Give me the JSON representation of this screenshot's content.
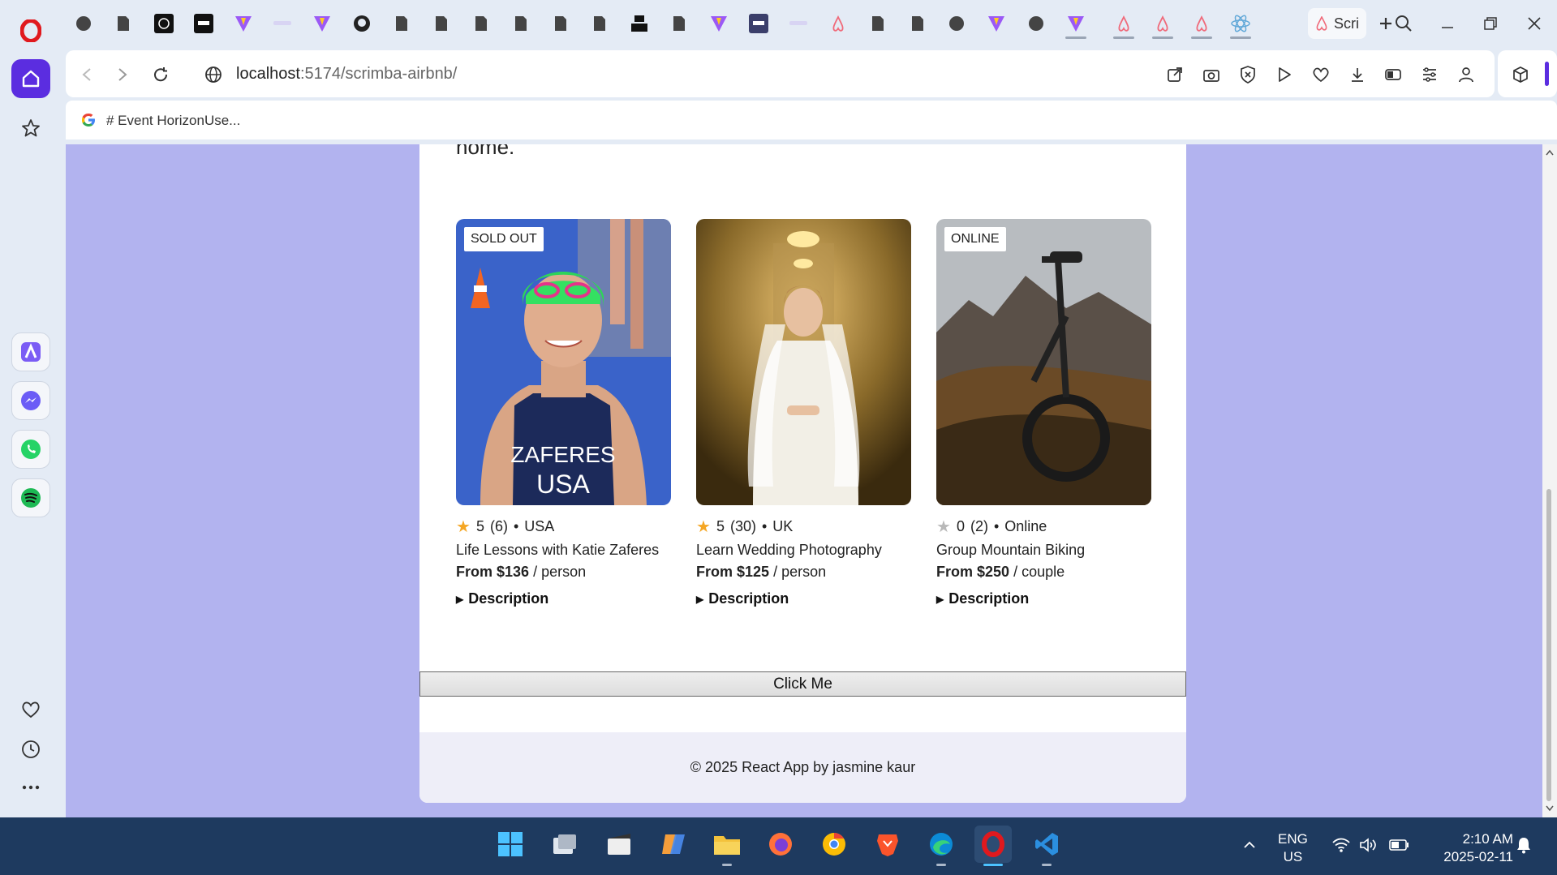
{
  "browser": {
    "active_tab_label": "Scri",
    "url_host": "localhost",
    "url_path": ":5174/scrimba-airbnb/",
    "bookmark_text": "# Event HorizonUse..."
  },
  "page": {
    "intro_tail": "home.",
    "cards": [
      {
        "badge": "SOLD OUT",
        "rating": "5",
        "review_count": "(6)",
        "location": "USA",
        "title": "Life Lessons with Katie Zaferes",
        "price": "From $136",
        "unit": "person",
        "description_label": "Description",
        "jersey_text_1": "ZAFERES",
        "jersey_text_2": "USA",
        "star_filled": true
      },
      {
        "badge": "",
        "rating": "5",
        "review_count": "(30)",
        "location": "UK",
        "title": "Learn Wedding Photography",
        "price": "From $125",
        "unit": "person",
        "description_label": "Description",
        "star_filled": true
      },
      {
        "badge": "ONLINE",
        "rating": "0",
        "review_count": "(2)",
        "location": "Online",
        "title": "Group Mountain Biking",
        "price": "From $250",
        "unit": "couple",
        "description_label": "Description",
        "star_filled": false
      }
    ],
    "separator": "•",
    "slash": "/",
    "button_label": "Click Me",
    "footer": "© 2025 React App by jasmine kaur"
  },
  "taskbar": {
    "lang_line1": "ENG",
    "lang_line2": "US",
    "time": "2:10 AM",
    "date": "2025-02-11"
  },
  "colors": {
    "page_background": "#b2b3ef",
    "star_active": "#f5a623",
    "opera_red": "#e0191e",
    "taskbar": "#1e3a5f"
  }
}
